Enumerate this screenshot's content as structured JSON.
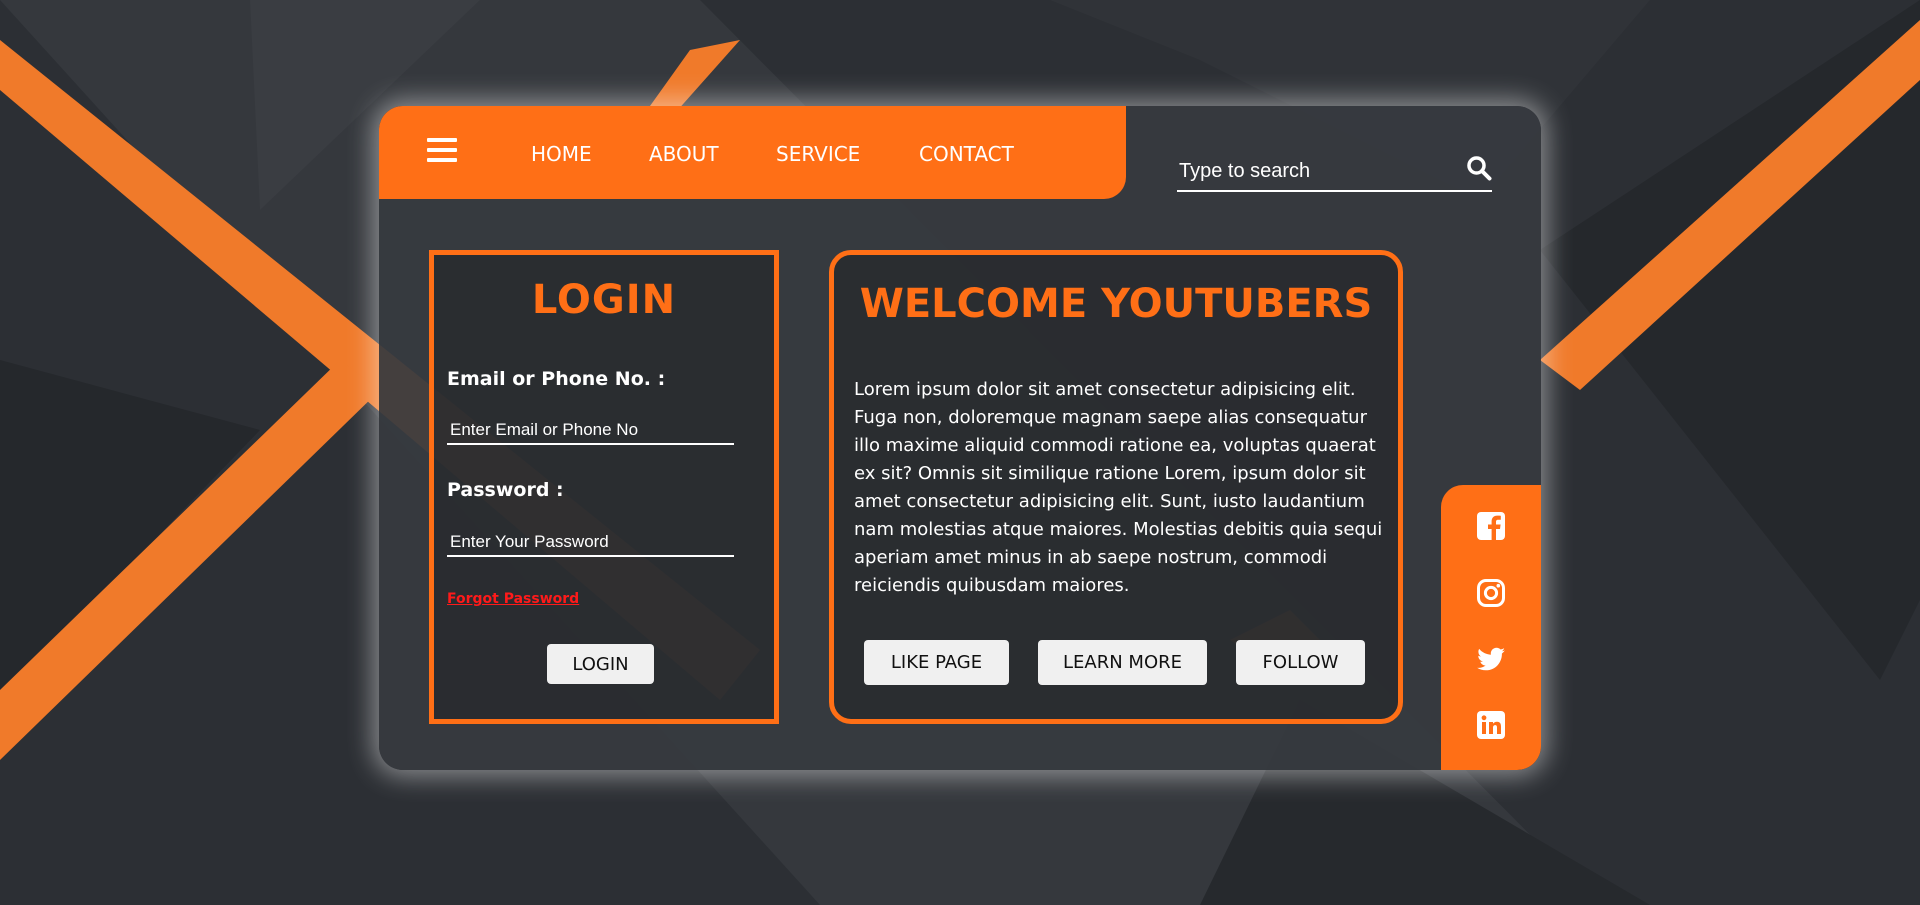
{
  "colors": {
    "accent": "#ff6f16",
    "card": "#373a3f",
    "link_red": "#ff1a1a",
    "button_bg": "#f0f0f0"
  },
  "nav": {
    "menu_icon": "hamburger-icon",
    "links": [
      "HOME",
      "ABOUT",
      "SERVICE",
      "CONTACT"
    ]
  },
  "search": {
    "placeholder": "Type to search",
    "value": "",
    "icon": "search-icon"
  },
  "login": {
    "title": "LOGIN",
    "email_label": "Email or Phone No. :",
    "email_placeholder": "Enter Email or Phone No",
    "password_label": "Password :",
    "password_placeholder": "Enter Your Password",
    "forgot_link": "Forgot Password",
    "submit_label": "LOGIN"
  },
  "welcome": {
    "title": "WELCOME YOUTUBERS",
    "body": "Lorem ipsum dolor sit amet consectetur adipisicing elit. Fuga non, doloremque magnam saepe alias consequatur illo maxime aliquid commodi ratione ea, voluptas quaerat ex sit? Omnis sit similique ratione Lorem, ipsum dolor sit amet consectetur adipisicing elit. Sunt, iusto laudantium nam molestias atque maiores. Molestias debitis quia sequi aperiam amet minus in ab saepe nostrum, commodi reiciendis quibusdam maiores.",
    "buttons": [
      "LIKE PAGE",
      "LEARN MORE",
      "FOLLOW"
    ]
  },
  "social": [
    "facebook-icon",
    "instagram-icon",
    "twitter-icon",
    "linkedin-icon"
  ]
}
